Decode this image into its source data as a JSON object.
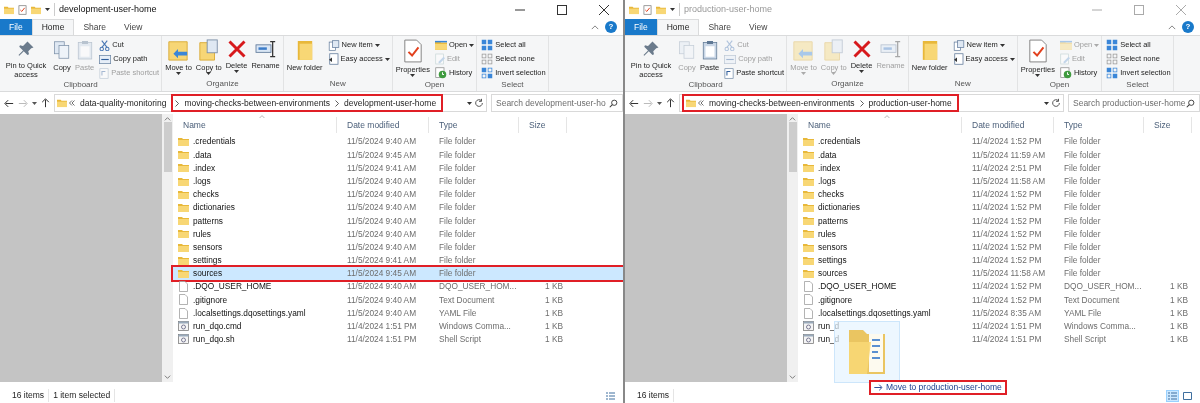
{
  "windows": [
    {
      "title": "development-user-home",
      "active": true,
      "tabs": [
        {
          "label": "File",
          "kind": "menu",
          "selected": false
        },
        {
          "label": "Home",
          "kind": "tab",
          "selected": true
        },
        {
          "label": "Share",
          "kind": "tab",
          "selected": false
        },
        {
          "label": "View",
          "kind": "tab",
          "selected": false
        }
      ],
      "help": "?",
      "ribbon": [
        {
          "label": "Clipboard",
          "items": [
            {
              "label": "Pin to Quick access",
              "kind": "large",
              "disabled": false,
              "dropdown": false
            },
            {
              "label": "Copy",
              "kind": "large",
              "disabled": false,
              "dropdown": false
            },
            {
              "label": "Paste",
              "kind": "large",
              "disabled": true,
              "dropdown": false
            },
            {
              "label": "Cut",
              "kind": "small",
              "disabled": false,
              "dropdown": false
            },
            {
              "label": "Copy path",
              "kind": "small",
              "disabled": false,
              "dropdown": false
            },
            {
              "label": "Paste shortcut",
              "kind": "small",
              "disabled": true,
              "dropdown": false
            }
          ]
        },
        {
          "label": "Organize",
          "items": [
            {
              "label": "Move to",
              "kind": "large",
              "disabled": false,
              "dropdown": true
            },
            {
              "label": "Copy to",
              "kind": "large",
              "disabled": false,
              "dropdown": true
            },
            {
              "label": "Delete",
              "kind": "large",
              "disabled": false,
              "dropdown": true
            },
            {
              "label": "Rename",
              "kind": "large",
              "disabled": false,
              "dropdown": false
            }
          ]
        },
        {
          "label": "New",
          "items": [
            {
              "label": "New folder",
              "kind": "large",
              "disabled": false,
              "dropdown": false
            },
            {
              "label": "New item",
              "kind": "small",
              "disabled": false,
              "dropdown": true
            },
            {
              "label": "Easy access",
              "kind": "small",
              "disabled": false,
              "dropdown": true
            }
          ]
        },
        {
          "label": "Open",
          "items": [
            {
              "label": "Properties",
              "kind": "large",
              "disabled": false,
              "dropdown": true
            },
            {
              "label": "Open",
              "kind": "small",
              "disabled": false,
              "dropdown": true
            },
            {
              "label": "Edit",
              "kind": "small",
              "disabled": true,
              "dropdown": false
            },
            {
              "label": "History",
              "kind": "small",
              "disabled": false,
              "dropdown": false
            }
          ]
        },
        {
          "label": "Select",
          "items": [
            {
              "label": "Select all",
              "kind": "small",
              "disabled": false,
              "dropdown": false
            },
            {
              "label": "Select none",
              "kind": "small",
              "disabled": false,
              "dropdown": false
            },
            {
              "label": "Invert selection",
              "kind": "small",
              "disabled": false,
              "dropdown": false
            }
          ]
        }
      ],
      "address": {
        "crumbs": [
          {
            "label": "data-quality-monitoring",
            "highlighted": false
          },
          {
            "label": "moving-checks-between-environments",
            "highlighted": true
          },
          {
            "label": "development-user-home",
            "highlighted": true
          }
        ]
      },
      "search": {
        "placeholder": "Search development-user-ho"
      },
      "columns": [
        "Name",
        "Date modified",
        "Type",
        "Size"
      ],
      "rows": [
        {
          "name": ".credentials",
          "date": "11/5/2024 9:40 AM",
          "type": "File folder",
          "size": "",
          "kind": "folder",
          "selected": false,
          "highlighted": false
        },
        {
          "name": ".data",
          "date": "11/5/2024 9:45 AM",
          "type": "File folder",
          "size": "",
          "kind": "folder",
          "selected": false,
          "highlighted": false
        },
        {
          "name": ".index",
          "date": "11/5/2024 9:41 AM",
          "type": "File folder",
          "size": "",
          "kind": "folder",
          "selected": false,
          "highlighted": false
        },
        {
          "name": ".logs",
          "date": "11/5/2024 9:40 AM",
          "type": "File folder",
          "size": "",
          "kind": "folder",
          "selected": false,
          "highlighted": false
        },
        {
          "name": "checks",
          "date": "11/5/2024 9:40 AM",
          "type": "File folder",
          "size": "",
          "kind": "folder",
          "selected": false,
          "highlighted": false
        },
        {
          "name": "dictionaries",
          "date": "11/5/2024 9:40 AM",
          "type": "File folder",
          "size": "",
          "kind": "folder",
          "selected": false,
          "highlighted": false
        },
        {
          "name": "patterns",
          "date": "11/5/2024 9:40 AM",
          "type": "File folder",
          "size": "",
          "kind": "folder",
          "selected": false,
          "highlighted": false
        },
        {
          "name": "rules",
          "date": "11/5/2024 9:40 AM",
          "type": "File folder",
          "size": "",
          "kind": "folder",
          "selected": false,
          "highlighted": false
        },
        {
          "name": "sensors",
          "date": "11/5/2024 9:40 AM",
          "type": "File folder",
          "size": "",
          "kind": "folder",
          "selected": false,
          "highlighted": false
        },
        {
          "name": "settings",
          "date": "11/5/2024 9:41 AM",
          "type": "File folder",
          "size": "",
          "kind": "folder",
          "selected": false,
          "highlighted": false
        },
        {
          "name": "sources",
          "date": "11/5/2024 9:45 AM",
          "type": "File folder",
          "size": "",
          "kind": "folder",
          "selected": true,
          "highlighted": true
        },
        {
          "name": ".DQO_USER_HOME",
          "date": "11/5/2024 9:40 AM",
          "type": "DQO_USER_HOM...",
          "size": "1 KB",
          "kind": "file",
          "selected": false,
          "highlighted": false
        },
        {
          "name": ".gitignore",
          "date": "11/5/2024 9:40 AM",
          "type": "Text Document",
          "size": "1 KB",
          "kind": "file",
          "selected": false,
          "highlighted": false
        },
        {
          "name": ".localsettings.dqosettings.yaml",
          "date": "11/5/2024 9:40 AM",
          "type": "YAML File",
          "size": "1 KB",
          "kind": "file",
          "selected": false,
          "highlighted": false
        },
        {
          "name": "run_dqo.cmd",
          "date": "11/4/2024 1:51 PM",
          "type": "Windows Comma...",
          "size": "1 KB",
          "kind": "script",
          "selected": false,
          "highlighted": false
        },
        {
          "name": "run_dqo.sh",
          "date": "11/4/2024 1:51 PM",
          "type": "Shell Script",
          "size": "1 KB",
          "kind": "script",
          "selected": false,
          "highlighted": false
        }
      ],
      "status": [
        "16 items",
        "1 item selected"
      ],
      "views": [
        {
          "selected": false
        }
      ]
    },
    {
      "title": "production-user-home",
      "active": false,
      "tabs": [
        {
          "label": "File",
          "kind": "menu",
          "selected": false
        },
        {
          "label": "Home",
          "kind": "tab",
          "selected": true
        },
        {
          "label": "Share",
          "kind": "tab",
          "selected": false
        },
        {
          "label": "View",
          "kind": "tab",
          "selected": false
        }
      ],
      "help": "?",
      "ribbon": [
        {
          "label": "Clipboard",
          "items": [
            {
              "label": "Pin to Quick access",
              "kind": "large",
              "disabled": false,
              "dropdown": false
            },
            {
              "label": "Copy",
              "kind": "large",
              "disabled": true,
              "dropdown": false
            },
            {
              "label": "Paste",
              "kind": "large",
              "disabled": false,
              "dropdown": false
            },
            {
              "label": "Cut",
              "kind": "small",
              "disabled": true,
              "dropdown": false
            },
            {
              "label": "Copy path",
              "kind": "small",
              "disabled": true,
              "dropdown": false
            },
            {
              "label": "Paste shortcut",
              "kind": "small",
              "disabled": false,
              "dropdown": false
            }
          ]
        },
        {
          "label": "Organize",
          "items": [
            {
              "label": "Move to",
              "kind": "large",
              "disabled": true,
              "dropdown": true
            },
            {
              "label": "Copy to",
              "kind": "large",
              "disabled": true,
              "dropdown": true
            },
            {
              "label": "Delete",
              "kind": "large",
              "disabled": false,
              "dropdown": true
            },
            {
              "label": "Rename",
              "kind": "large",
              "disabled": true,
              "dropdown": false
            }
          ]
        },
        {
          "label": "New",
          "items": [
            {
              "label": "New folder",
              "kind": "large",
              "disabled": false,
              "dropdown": false
            },
            {
              "label": "New item",
              "kind": "small",
              "disabled": false,
              "dropdown": true
            },
            {
              "label": "Easy access",
              "kind": "small",
              "disabled": false,
              "dropdown": true
            }
          ]
        },
        {
          "label": "Open",
          "items": [
            {
              "label": "Properties",
              "kind": "large",
              "disabled": false,
              "dropdown": true
            },
            {
              "label": "Open",
              "kind": "small",
              "disabled": true,
              "dropdown": true
            },
            {
              "label": "Edit",
              "kind": "small",
              "disabled": true,
              "dropdown": false
            },
            {
              "label": "History",
              "kind": "small",
              "disabled": false,
              "dropdown": false
            }
          ]
        },
        {
          "label": "Select",
          "items": [
            {
              "label": "Select all",
              "kind": "small",
              "disabled": false,
              "dropdown": false
            },
            {
              "label": "Select none",
              "kind": "small",
              "disabled": false,
              "dropdown": false
            },
            {
              "label": "Invert selection",
              "kind": "small",
              "disabled": false,
              "dropdown": false
            }
          ]
        }
      ],
      "address": {
        "crumbs": [
          {
            "label": "moving-checks-between-environments",
            "highlighted": true
          },
          {
            "label": "production-user-home",
            "highlighted": true
          }
        ]
      },
      "search": {
        "placeholder": "Search production-user-home"
      },
      "columns": [
        "Name",
        "Date modified",
        "Type",
        "Size"
      ],
      "rows": [
        {
          "name": ".credentials",
          "date": "11/4/2024 1:52 PM",
          "type": "File folder",
          "size": "",
          "kind": "folder",
          "selected": false,
          "highlighted": false
        },
        {
          "name": ".data",
          "date": "11/5/2024 11:59 AM",
          "type": "File folder",
          "size": "",
          "kind": "folder",
          "selected": false,
          "highlighted": false
        },
        {
          "name": ".index",
          "date": "11/4/2024 2:51 PM",
          "type": "File folder",
          "size": "",
          "kind": "folder",
          "selected": false,
          "highlighted": false
        },
        {
          "name": ".logs",
          "date": "11/5/2024 11:58 AM",
          "type": "File folder",
          "size": "",
          "kind": "folder",
          "selected": false,
          "highlighted": false
        },
        {
          "name": "checks",
          "date": "11/4/2024 1:52 PM",
          "type": "File folder",
          "size": "",
          "kind": "folder",
          "selected": false,
          "highlighted": false
        },
        {
          "name": "dictionaries",
          "date": "11/4/2024 1:52 PM",
          "type": "File folder",
          "size": "",
          "kind": "folder",
          "selected": false,
          "highlighted": false
        },
        {
          "name": "patterns",
          "date": "11/4/2024 1:52 PM",
          "type": "File folder",
          "size": "",
          "kind": "folder",
          "selected": false,
          "highlighted": false
        },
        {
          "name": "rules",
          "date": "11/4/2024 1:52 PM",
          "type": "File folder",
          "size": "",
          "kind": "folder",
          "selected": false,
          "highlighted": false
        },
        {
          "name": "sensors",
          "date": "11/4/2024 1:52 PM",
          "type": "File folder",
          "size": "",
          "kind": "folder",
          "selected": false,
          "highlighted": false
        },
        {
          "name": "settings",
          "date": "11/4/2024 1:52 PM",
          "type": "File folder",
          "size": "",
          "kind": "folder",
          "selected": false,
          "highlighted": false
        },
        {
          "name": "sources",
          "date": "11/5/2024 11:58 AM",
          "type": "File folder",
          "size": "",
          "kind": "folder",
          "selected": false,
          "highlighted": false
        },
        {
          "name": ".DQO_USER_HOME",
          "date": "11/4/2024 1:52 PM",
          "type": "DQO_USER_HOM...",
          "size": "1 KB",
          "kind": "file",
          "selected": false,
          "highlighted": false
        },
        {
          "name": ".gitignore",
          "date": "11/4/2024 1:52 PM",
          "type": "Text Document",
          "size": "1 KB",
          "kind": "file",
          "selected": false,
          "highlighted": false
        },
        {
          "name": ".localsettings.dqosettings.yaml",
          "date": "11/5/2024 8:35 AM",
          "type": "YAML File",
          "size": "1 KB",
          "kind": "file",
          "selected": false,
          "highlighted": false
        },
        {
          "name": "run_d",
          "date": "11/4/2024 1:51 PM",
          "type": "Windows Comma...",
          "size": "1 KB",
          "kind": "script",
          "selected": false,
          "highlighted": false
        },
        {
          "name": "run_d",
          "date": "11/4/2024 1:51 PM",
          "type": "Shell Script",
          "size": "1 KB",
          "kind": "script",
          "selected": false,
          "highlighted": false
        }
      ],
      "drag": {
        "tooltip": "Move to production-user-home"
      },
      "status": [
        "16 items"
      ],
      "views": [
        {
          "selected": true
        },
        {
          "selected": false
        }
      ]
    }
  ]
}
